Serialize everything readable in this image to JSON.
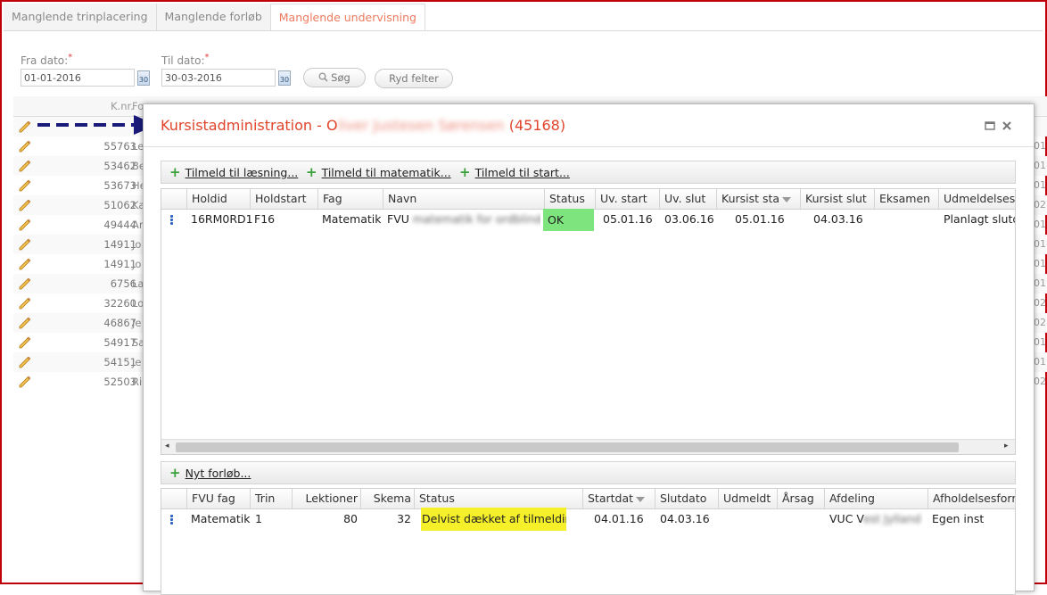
{
  "tabs": [
    {
      "label": "Manglende trinplacering"
    },
    {
      "label": "Manglende forløb"
    },
    {
      "label": "Manglende undervisning"
    }
  ],
  "filters": {
    "fra_label": "Fra dato:",
    "til_label": "Til dato:",
    "required_mark": "*",
    "fra_value": "01-01-2016",
    "til_value": "30-03-2016",
    "calendar_icon_text": "30",
    "search_label": "Søg",
    "clear_label": "Ryd felter"
  },
  "bg_grid": {
    "headers": [
      "K.nr.",
      "Fo"
    ],
    "rows": [
      {
        "knr": "",
        "name": "",
        "right": ""
      },
      {
        "knr": "55763",
        "name": "Le",
        "right": "01"
      },
      {
        "knr": "53462",
        "name": "Be",
        "right": "01"
      },
      {
        "knr": "53673",
        "name": "He",
        "right": "01"
      },
      {
        "knr": "51062",
        "name": "Ka",
        "right": "02"
      },
      {
        "knr": "49444",
        "name": "Ar",
        "right": "01"
      },
      {
        "knr": "14911",
        "name": "Jo",
        "right": "01"
      },
      {
        "knr": "14911",
        "name": "Jo",
        "right": "01"
      },
      {
        "knr": "6756",
        "name": "La",
        "right": "01"
      },
      {
        "knr": "32260",
        "name": "Lo",
        "right": "02"
      },
      {
        "knr": "46867",
        "name": "Je",
        "right": "02"
      },
      {
        "knr": "54917",
        "name": "Sa",
        "right": "01"
      },
      {
        "knr": "54151",
        "name": "Je",
        "right": "01"
      },
      {
        "knr": "52503",
        "name": "Ri",
        "right": "02"
      }
    ]
  },
  "modal": {
    "title_prefix": "Kursistadministration - O",
    "title_hidden": "liver Justesen Sørensen",
    "title_suffix": " (45168)",
    "toolbar1": [
      "Tilmeld til læsning...",
      "Tilmeld til matematik...",
      "Tilmeld til start..."
    ],
    "grid1": {
      "headers": [
        "Holdid",
        "Holdstart",
        "Fag",
        "Navn",
        "Status",
        "Uv. start",
        "Uv. slut",
        "Kursist sta",
        "Kursist slut",
        "Eksamen",
        "Udmeldelsesår"
      ],
      "row": {
        "holdid": "16RM0RD1",
        "holdstart": "F16",
        "fag": "Matematik",
        "navn": "FVU",
        "navn_hidden": " matematik for ordblinde",
        "status": "OK",
        "uv_start": "05.01.16",
        "uv_slut": "03.06.16",
        "kursist_start": "05.01.16",
        "kursist_slut": "04.03.16",
        "eksamen": "",
        "udmeld": "Planlagt slutd"
      }
    },
    "toolbar2": [
      "Nyt forløb..."
    ],
    "grid2": {
      "headers": [
        "FVU fag",
        "Trin",
        "Lektioner",
        "Skema",
        "Status",
        "Startdat",
        "Slutdato",
        "Udmeldt",
        "Årsag",
        "Afdeling",
        "Afholdelsesform"
      ],
      "row": {
        "fag": "Matematik",
        "trin": "1",
        "lektioner": "80",
        "skema": "32",
        "status": "Delvist dækket af tilmeldinger",
        "start": "04.01.16",
        "slut": "04.03.16",
        "udmeldt": "",
        "aarsag": "",
        "afdeling": "VUC V",
        "afdeling_hidden": "est Jylland",
        "afholdelse": "Egen inst"
      }
    }
  },
  "colors": {
    "frame": "#c0000a",
    "title": "#e0442a",
    "ok_highlight": "#7ee57e",
    "status_highlight": "#f5f02a",
    "arrow": "#1a1a7a",
    "plus": "#3aa03a"
  }
}
